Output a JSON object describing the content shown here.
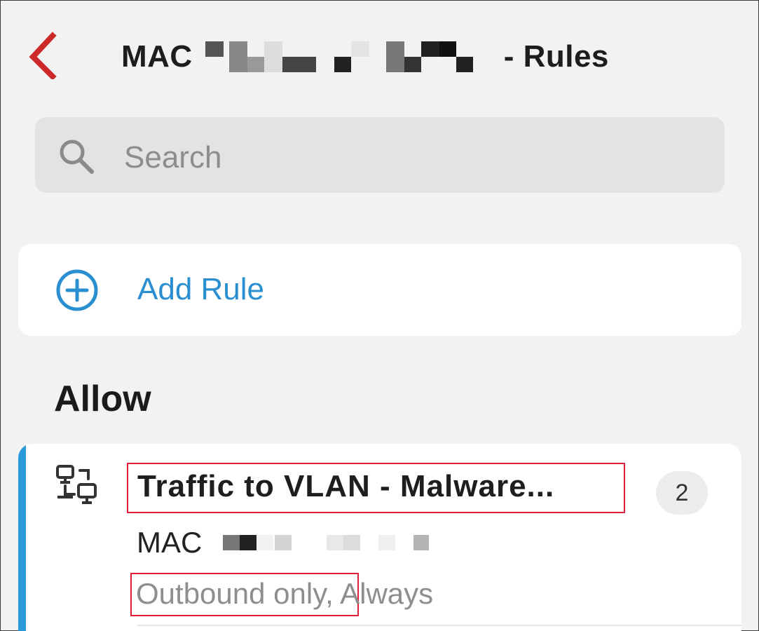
{
  "header": {
    "title_prefix": "MAC",
    "title_suffix": "- Rules"
  },
  "search": {
    "placeholder": "Search"
  },
  "add_rule": {
    "label": "Add Rule"
  },
  "sections": {
    "allow_title": "Allow"
  },
  "rules": [
    {
      "name": "Traffic to VLAN - Malware...",
      "count": "2",
      "mac_label": "MAC",
      "direction": "Outbound only",
      "schedule": ", Always",
      "accent_color": "#2a9ad8"
    }
  ],
  "colors": {
    "back_chevron": "#cc2a2a",
    "link_blue": "#2a8fd0",
    "highlight_box": "#e0203a"
  }
}
